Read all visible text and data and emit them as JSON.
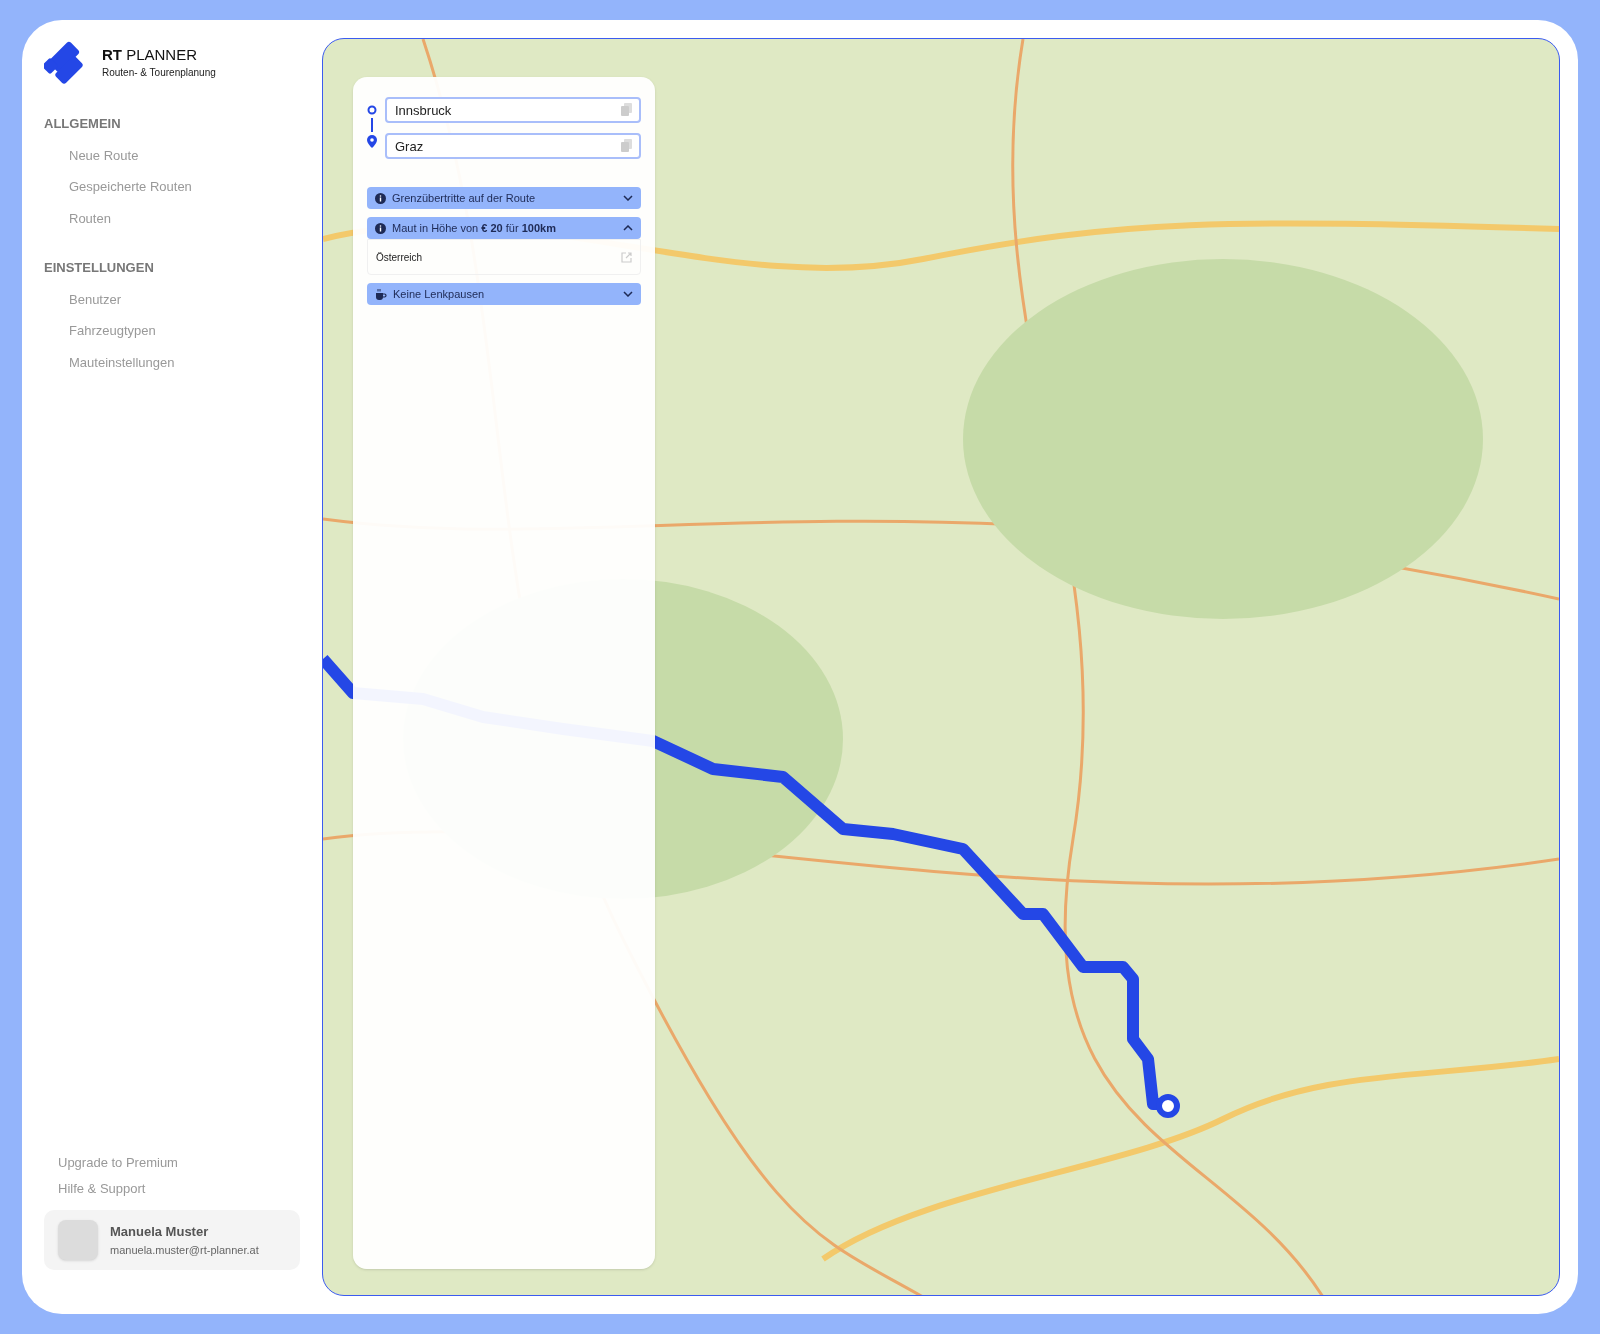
{
  "brand": {
    "name": "**RT** PLANNER",
    "tagline": "Routen- & Tourenplanung"
  },
  "nav_sections": [
    {
      "heading": "ALLGEMEIN",
      "items": [
        "Neue Route",
        "Gespeicherte Routen",
        "Routen"
      ]
    },
    {
      "heading": "EINSTELLUNGEN",
      "items": [
        "Benutzer",
        "Fahrzeugtypen",
        "Mauteinstellungen"
      ]
    }
  ],
  "footer_links": [
    "Upgrade to Premium",
    "Hilfe & Support"
  ],
  "user": {
    "name": "Manuela Muster",
    "email": "manuela.muster@rt-planner.at"
  },
  "route": {
    "start": "Innsbruck",
    "destination": "Graz"
  },
  "sections": [
    {
      "kind": "info",
      "title": "Grenzübertritte auf der Route",
      "expanded": false
    },
    {
      "kind": "info",
      "title": "Maut in Höhe von **€ 20** für **100km**",
      "expanded": true,
      "rows": [
        "Österreich"
      ]
    },
    {
      "kind": "break",
      "title": "Keine Lenkpausen",
      "expanded": false
    }
  ]
}
